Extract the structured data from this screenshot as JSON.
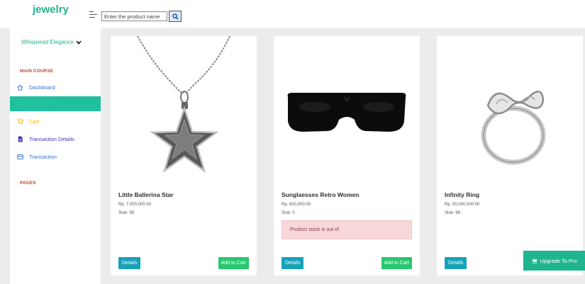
{
  "header": {
    "brand": "jewelry",
    "search_placeholder": "Enter the product name"
  },
  "sidebar": {
    "workspace": "Whispered Elegance",
    "section_main": "MAIN COURSE",
    "section_pages": "PAGES",
    "items": [
      {
        "label": "Dashboard",
        "icon": "home-icon",
        "color": "#2f6fd6",
        "active": false
      },
      {
        "label": "Product List",
        "icon": "grid-icon",
        "color": "#2ec9a5",
        "active": true
      },
      {
        "label": "Cart",
        "icon": "cart-icon",
        "color": "#f4b400",
        "active": false
      },
      {
        "label": "Transaction Details",
        "icon": "document-icon",
        "color": "#4b2fb8",
        "active": false
      },
      {
        "label": "Transaction",
        "icon": "card-icon",
        "color": "#2f6fd6",
        "active": false
      }
    ]
  },
  "products": [
    {
      "name": "Little Ballerina Star",
      "price": "Rp. 7,000,000.00",
      "stock": "Stok: 99",
      "details_label": "Details",
      "cart_label": "Add to Cart"
    },
    {
      "name": "Sunglaesses Retro Women",
      "price": "Rp. 600,000.00",
      "stock": "Stok: 0",
      "alert": "Product stock is out of.",
      "details_label": "Details",
      "cart_label": "Add to Cart"
    },
    {
      "name": "Infinity Ring",
      "price": "Rp. 50,000,000.00",
      "stock": "Stok: 99",
      "details_label": "Details"
    }
  ],
  "upgrade_label": "Upgrade To Pro",
  "colors": {
    "accent": "#1fb58f",
    "details": "#17a2b8",
    "cart": "#28c76f",
    "alert_bg": "#f8d7da"
  }
}
